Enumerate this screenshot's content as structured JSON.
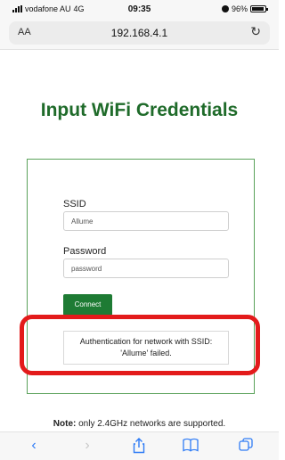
{
  "status_bar": {
    "carrier": "vodafone AU",
    "network": "4G",
    "time": "09:35",
    "battery": "96%",
    "battery_level": 0.96
  },
  "address_bar": {
    "text_size_label": "AA",
    "url": "192.168.4.1",
    "reload_icon": "reload-icon"
  },
  "page": {
    "title": "Input WiFi Credentials",
    "form": {
      "ssid_label": "SSID",
      "ssid_value": "Allume",
      "password_label": "Password",
      "password_placeholder": "password",
      "connect_label": "Connect",
      "message": "Authentication for network with SSID: 'Allume' failed."
    },
    "note_bold": "Note:",
    "note_text": "only 2.4GHz networks are supported."
  },
  "colors": {
    "title": "#1f6b2a",
    "card_border": "#5ba25b",
    "connect_button": "#1e7b34",
    "highlight": "#e31b1b",
    "toolbar_icon": "#2f7cf6"
  },
  "toolbar": {
    "icons": [
      "back-icon",
      "forward-icon",
      "share-icon",
      "bookmarks-icon",
      "tabs-icon"
    ]
  }
}
